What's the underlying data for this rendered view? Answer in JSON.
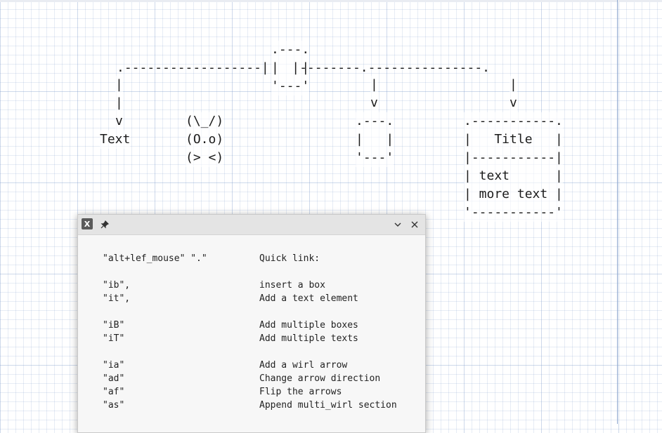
{
  "canvas": {
    "diagram_lines": [
      "                        .---.",
      " .-------------------.  |   |  .--------.-----------------.",
      " |                      '---'           |                  |",
      " |                                      v                  v",
      " v         (\\_/)                      .---.            .-----------.",
      "Text       (O.o)                      |   |            |   Title   |",
      "           (> <)                      '---'            |-----------|",
      "                                                       | text      |",
      "                                                       | more text |",
      "                                                       '-----------'"
    ],
    "top_box": [
      ".---.",
      "|   |",
      "'---'"
    ],
    "connector_line": ".------------------|   |--------.---------------.",
    "left_branch": [
      "|",
      "|",
      "v",
      "Text"
    ],
    "kitty": [
      "(\\_/)",
      "(O.o)",
      "(> <)"
    ],
    "mid_branch": [
      "|",
      "v"
    ],
    "small_box": [
      ".---.",
      "|   |",
      "'---'"
    ],
    "right_branch": [
      "|",
      "v"
    ],
    "title_box": [
      ".-----------.",
      "|   Title   |",
      "|-----------|",
      "| text      |",
      "| more text |",
      "'-----------'"
    ]
  },
  "popup": {
    "icons": {
      "app": "x-app-icon",
      "pin": "pin-icon",
      "minimize": "chevron-down-icon",
      "close": "close-icon"
    },
    "shortcuts": [
      {
        "key": "\"alt+lef_mouse\" \".\"",
        "desc": "Quick link:"
      },
      {
        "key": "",
        "desc": ""
      },
      {
        "key": "\"ib\",",
        "desc": "insert a box"
      },
      {
        "key": "\"it\",",
        "desc": "Add a text element"
      },
      {
        "key": "",
        "desc": ""
      },
      {
        "key": "\"iB\"",
        "desc": "Add multiple boxes"
      },
      {
        "key": "\"iT\"",
        "desc": "Add multiple texts"
      },
      {
        "key": "",
        "desc": ""
      },
      {
        "key": "\"ia\"",
        "desc": "Add a wirl arrow"
      },
      {
        "key": "\"ad\"",
        "desc": "Change arrow direction"
      },
      {
        "key": "\"af\"",
        "desc": "Flip the arrows"
      },
      {
        "key": "\"as\"",
        "desc": "Append multi_wirl section"
      }
    ]
  }
}
